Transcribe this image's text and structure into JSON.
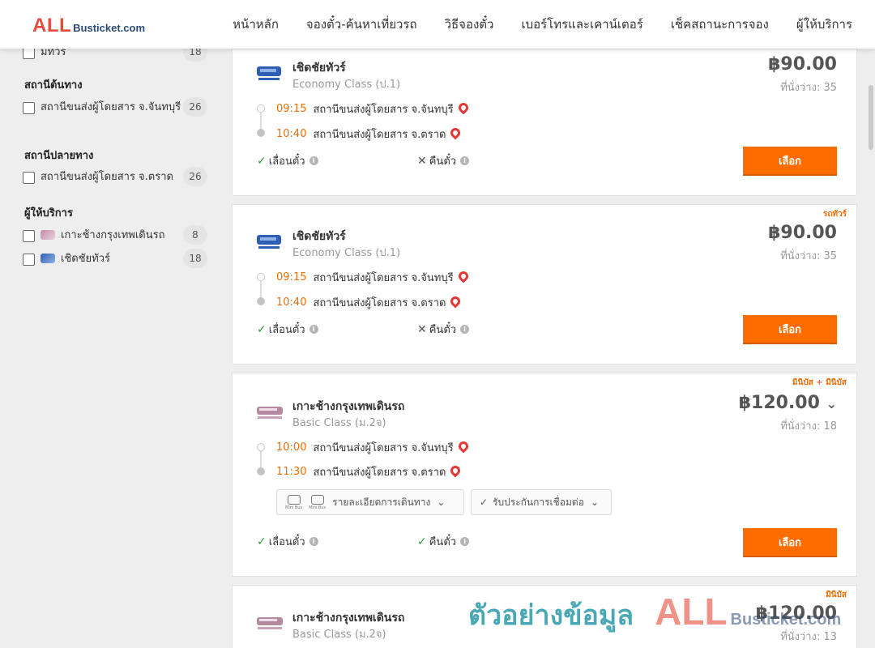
{
  "header": {
    "logo_all": "ALL",
    "logo_rest": "Busticket.com",
    "nav": [
      "หน้าหลัก",
      "จองตั๋ว-ค้นหาเที่ยวรถ",
      "วิธีจองตั๋ว",
      "เบอร์โทรและเคาน์เตอร์",
      "เช็คสถานะการจอง",
      "ผู้ให้บริการ"
    ]
  },
  "sidebar": {
    "top_item": {
      "label": "มีทัวร์",
      "count": "18"
    },
    "origin_title": "สถานีต้นทาง",
    "origin_item": {
      "label": "สถานีขนส่งผู้โดยสาร จ.จันทบุรี",
      "count": "26"
    },
    "dest_title": "สถานีปลายทาง",
    "dest_item": {
      "label": "สถานีขนส่งผู้โดยสาร จ.ตราด",
      "count": "26"
    },
    "operator_title": "ผู้ให้บริการ",
    "operators": [
      {
        "label": "เกาะช้างกรุงเทพเดินรถ",
        "count": "8"
      },
      {
        "label": "เชิดชัยทัวร์",
        "count": "18"
      }
    ]
  },
  "cards": [
    {
      "badge": "",
      "operator": "เชิดชัยทัวร์",
      "class": "Economy Class (ป.1)",
      "price": "฿90.00",
      "seats": "ที่นั่งว่าง: 35",
      "dep_time": "09:15",
      "dep_station": "สถานีขนส่งผู้โดยสาร จ.จันทบุรี",
      "arr_time": "10:40",
      "arr_station": "สถานีขนส่งผู้โดยสาร จ.ตราด",
      "opt1": "เลื่อนตั๋ว",
      "opt2": "คืนตั๋ว",
      "select": "เลือก"
    },
    {
      "badge": "รถทัวร์",
      "operator": "เชิดชัยทัวร์",
      "class": "Economy Class (ป.1)",
      "price": "฿90.00",
      "seats": "ที่นั่งว่าง: 35",
      "dep_time": "09:15",
      "dep_station": "สถานีขนส่งผู้โดยสาร จ.จันทบุรี",
      "arr_time": "10:40",
      "arr_station": "สถานีขนส่งผู้โดยสาร จ.ตราด",
      "opt1": "เลื่อนตั๋ว",
      "opt2": "คืนตั๋ว",
      "select": "เลือก"
    },
    {
      "badge": "มินิบัส + มินิบัส",
      "operator": "เกาะช้างกรุงเทพเดินรถ",
      "class": "Basic Class (ม.2จ)",
      "price": "฿120.00",
      "seats": "ที่นั่งว่าง: 18",
      "dep_time": "10:00",
      "dep_station": "สถานีขนส่งผู้โดยสาร จ.จันทบุรี",
      "arr_time": "11:30",
      "arr_station": "สถานีขนส่งผู้โดยสาร จ.ตราด",
      "bus_label": "Mini Bus",
      "chip1": "รายละเอียดการเดินทาง",
      "chip2": "รับประกันการเชื่อมต่อ",
      "opt1": "เลื่อนตั๋ว",
      "opt2": "คืนตั๋ว",
      "select": "เลือก"
    },
    {
      "badge": "มินิบัส",
      "operator": "เกาะช้างกรุงเทพเดินรถ",
      "class": "Basic Class (ม.2จ)",
      "price": "฿120.00",
      "seats": "ที่นั่งว่าง: 13"
    }
  ],
  "watermark": {
    "text": "ตัวอย่างข้อมูล",
    "all": "ALL",
    "rest": "Busticket.com"
  }
}
